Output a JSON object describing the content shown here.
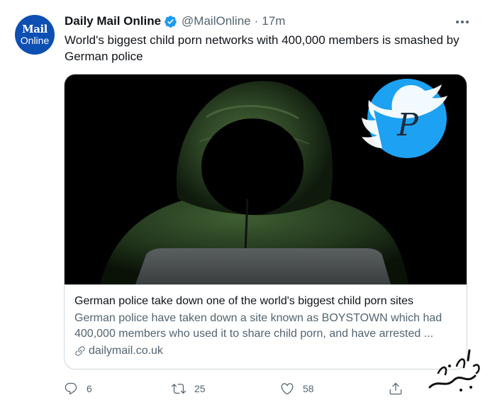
{
  "tweet": {
    "avatar": {
      "line1": "Mail",
      "line2": "Online",
      "color": "#0d4fb3"
    },
    "display_name": "Daily Mail Online",
    "handle": "@MailOnline",
    "separator": "·",
    "time": "17m",
    "text": "World's biggest child porn networks with 400,000 members is smashed by German police"
  },
  "card": {
    "title": "German police take down one of the world's biggest child porn sites",
    "description": "German police have taken down a site known as BOYSTOWN which had 400,000 members who used it to share child porn, and have arrested ...",
    "domain": "dailymail.co.uk",
    "image": {
      "subject": "hooded-figure-at-laptop",
      "badge_letter": "P",
      "badge_color": "#1da1f2"
    }
  },
  "actions": {
    "reply_count": "6",
    "retweet_count": "25",
    "like_count": "58"
  },
  "colors": {
    "accent": "#1d9bf0",
    "secondary_text": "#536471",
    "border": "#cfd9de"
  }
}
